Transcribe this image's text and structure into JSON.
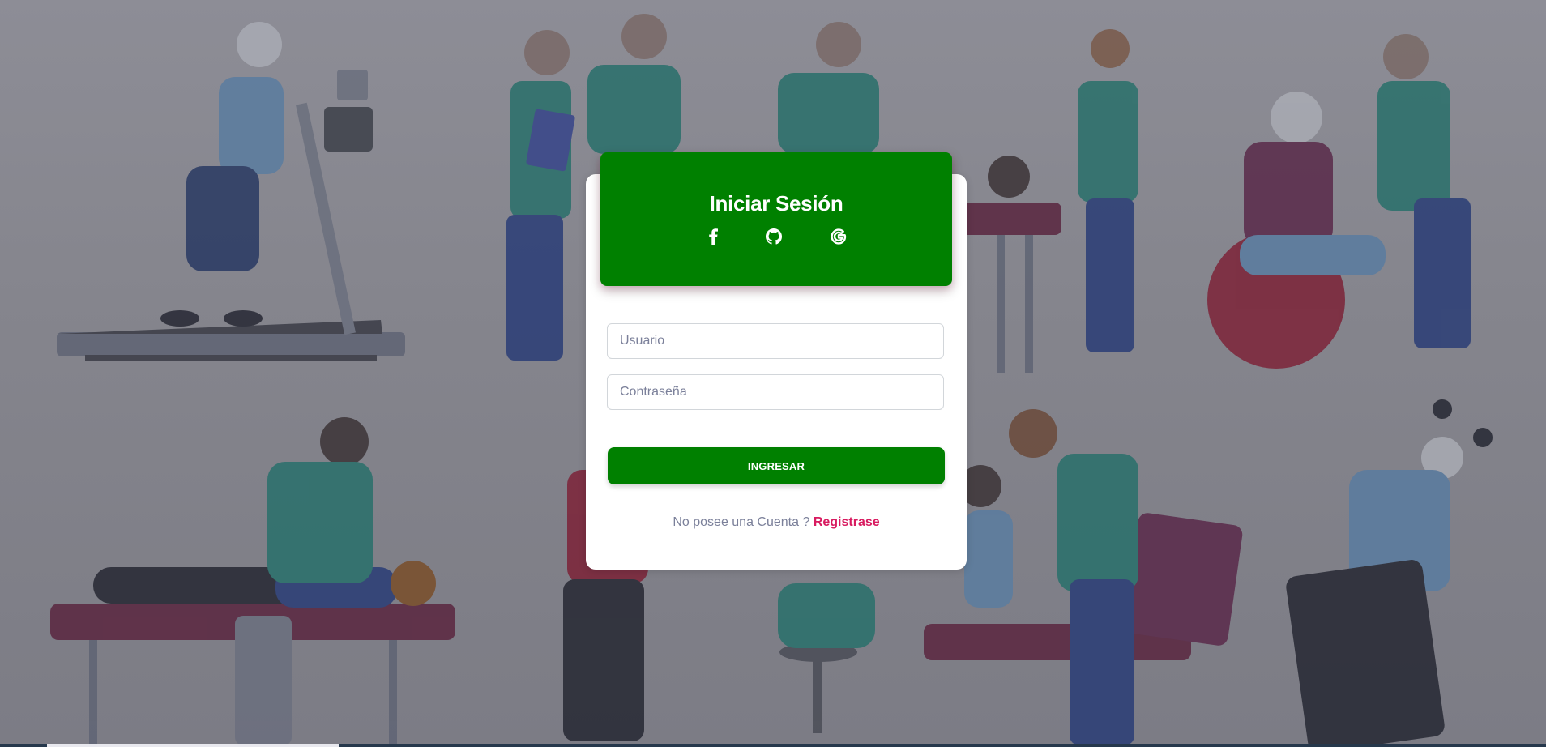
{
  "login": {
    "title": "Iniciar Sesión",
    "social": [
      {
        "name": "facebook",
        "icon": "facebook-icon"
      },
      {
        "name": "github",
        "icon": "github-icon"
      },
      {
        "name": "google",
        "icon": "google-icon"
      }
    ],
    "username": {
      "placeholder": "Usuario",
      "value": ""
    },
    "password": {
      "placeholder": "Contraseña",
      "value": ""
    },
    "submit_label": "INGRESAR",
    "register_prompt": "No posee una Cuenta ?",
    "register_link": "Registrase"
  },
  "colors": {
    "primary_green": "#008000",
    "link_pink": "#d81b60",
    "background_overlay": "#85858d"
  }
}
